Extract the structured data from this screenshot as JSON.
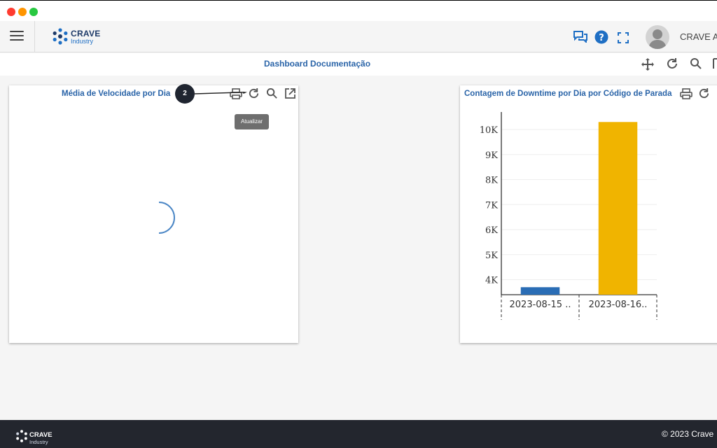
{
  "window": {
    "close_color": "#ff3b30",
    "minimize_color": "#ff9500",
    "maximize_color": "#28c840"
  },
  "brand": {
    "name": "CRAVE",
    "sub": "Industry"
  },
  "header": {
    "user_name": "CRAVE A"
  },
  "dashboard": {
    "title": "Dashboard Documentação"
  },
  "panel_left": {
    "title": "Média de Velocidade por Dia",
    "annotation_step": "2",
    "tooltip": "Atualizar"
  },
  "panel_right": {
    "title": "Contagem de Downtime por Dia por Código de Parada"
  },
  "chart_data": {
    "type": "bar",
    "categories": [
      "2023-08-15 ..",
      "2023-08-16.."
    ],
    "values": [
      3700,
      10300
    ],
    "colors": [
      "#2a6db5",
      "#f0b400"
    ],
    "ylim": [
      3400,
      10700
    ],
    "yticks": [
      4000,
      5000,
      6000,
      7000,
      8000,
      9000,
      10000
    ],
    "ytick_labels": [
      "4K",
      "5K",
      "6K",
      "7K",
      "8K",
      "9K",
      "10K"
    ],
    "grid": true
  },
  "footer": {
    "brand_name": "CRAVE",
    "brand_sub": "Industry",
    "copyright": "© 2023 Crave"
  }
}
